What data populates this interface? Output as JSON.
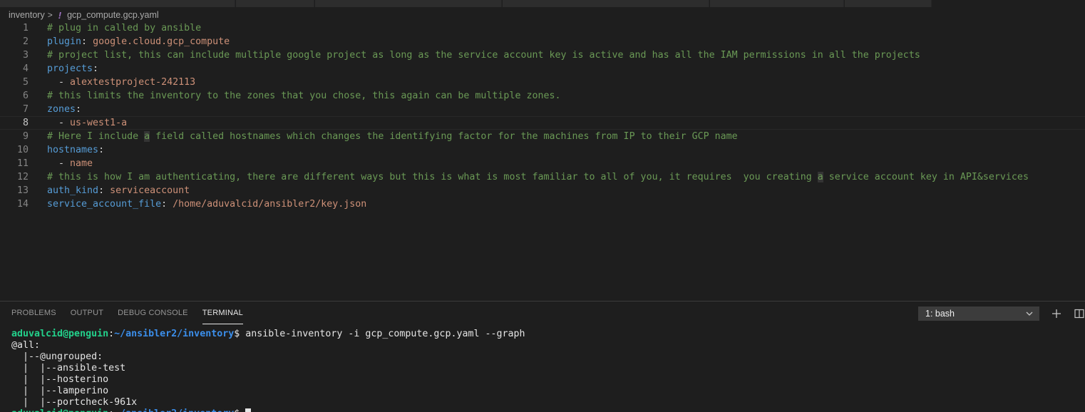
{
  "breadcrumb": {
    "folder": "inventory",
    "separator": ">",
    "file_icon": "!",
    "file": "gcp_compute.gcp.yaml"
  },
  "editor": {
    "current_line": 8,
    "lines": [
      {
        "n": "1",
        "parts": [
          {
            "t": "# plug in called by ansible",
            "k": "comment"
          }
        ]
      },
      {
        "n": "2",
        "parts": [
          {
            "t": "plugin",
            "k": "key"
          },
          {
            "t": ": ",
            "k": "punc"
          },
          {
            "t": "google.cloud.gcp_compute",
            "k": "str"
          }
        ]
      },
      {
        "n": "3",
        "parts": [
          {
            "t": "# project list, this can include multiple google project as long as the service account key is active and has all the IAM permissions in all the projects",
            "k": "comment"
          }
        ]
      },
      {
        "n": "4",
        "parts": [
          {
            "t": "projects",
            "k": "key"
          },
          {
            "t": ":",
            "k": "punc"
          }
        ]
      },
      {
        "n": "5",
        "parts": [
          {
            "t": "  - ",
            "k": "punc"
          },
          {
            "t": "alextestproject-242113",
            "k": "str"
          }
        ]
      },
      {
        "n": "6",
        "parts": [
          {
            "t": "# this limits the inventory to the zones that you chose, this again can be multiple zones.",
            "k": "comment"
          }
        ]
      },
      {
        "n": "7",
        "parts": [
          {
            "t": "zones",
            "k": "key"
          },
          {
            "t": ":",
            "k": "punc"
          }
        ]
      },
      {
        "n": "8",
        "parts": [
          {
            "t": "  - ",
            "k": "punc"
          },
          {
            "t": "us-west1-a",
            "k": "str"
          }
        ]
      },
      {
        "n": "9",
        "parts": [
          {
            "t": "# Here I include ",
            "k": "comment"
          },
          {
            "t": "a",
            "k": "comment-hl"
          },
          {
            "t": " field called hostnames which changes the identifying factor for the machines from IP to their GCP name",
            "k": "comment"
          }
        ]
      },
      {
        "n": "10",
        "parts": [
          {
            "t": "hostnames",
            "k": "key"
          },
          {
            "t": ":",
            "k": "punc"
          }
        ]
      },
      {
        "n": "11",
        "parts": [
          {
            "t": "  - ",
            "k": "punc"
          },
          {
            "t": "name",
            "k": "str"
          }
        ]
      },
      {
        "n": "12",
        "parts": [
          {
            "t": "# this is how I am authenticating, there are different ways but this is what is most familiar to all of you, it requires  you creating ",
            "k": "comment"
          },
          {
            "t": "a",
            "k": "comment-hl"
          },
          {
            "t": " service account key in API&services",
            "k": "comment"
          }
        ]
      },
      {
        "n": "13",
        "parts": [
          {
            "t": "auth_kind",
            "k": "key"
          },
          {
            "t": ": ",
            "k": "punc"
          },
          {
            "t": "serviceaccount",
            "k": "str"
          }
        ]
      },
      {
        "n": "14",
        "parts": [
          {
            "t": "service_account_file",
            "k": "key"
          },
          {
            "t": ": ",
            "k": "punc"
          },
          {
            "t": "/home/aduvalcid/ansibler2/key.json",
            "k": "str"
          }
        ]
      }
    ]
  },
  "panel": {
    "tabs": [
      {
        "label": "PROBLEMS",
        "name": "tab-problems",
        "active": false
      },
      {
        "label": "OUTPUT",
        "name": "tab-output",
        "active": false
      },
      {
        "label": "DEBUG CONSOLE",
        "name": "tab-debug-console",
        "active": false
      },
      {
        "label": "TERMINAL",
        "name": "tab-terminal",
        "active": true
      }
    ],
    "terminal_select": "1: bash",
    "add_icon": "plus-icon",
    "split_icon": "split-terminal-icon"
  },
  "terminal": {
    "prompt_user": "aduvalcid@penguin",
    "prompt_sep": ":",
    "prompt_path": "~/ansibler2/inventory",
    "prompt_end": "$ ",
    "command": "ansible-inventory -i gcp_compute.gcp.yaml --graph",
    "output": [
      "@all:",
      "  |--@ungrouped:",
      "  |  |--ansible-test",
      "  |  |--hosterino",
      "  |  |--lamperino",
      "  |  |--portcheck-961x"
    ]
  },
  "colors": {
    "background": "#1e1e1e",
    "comment": "#6a9955",
    "key": "#569cd6",
    "string": "#ce9178",
    "terminal_user": "#23d18b",
    "terminal_path": "#3b8eea"
  }
}
